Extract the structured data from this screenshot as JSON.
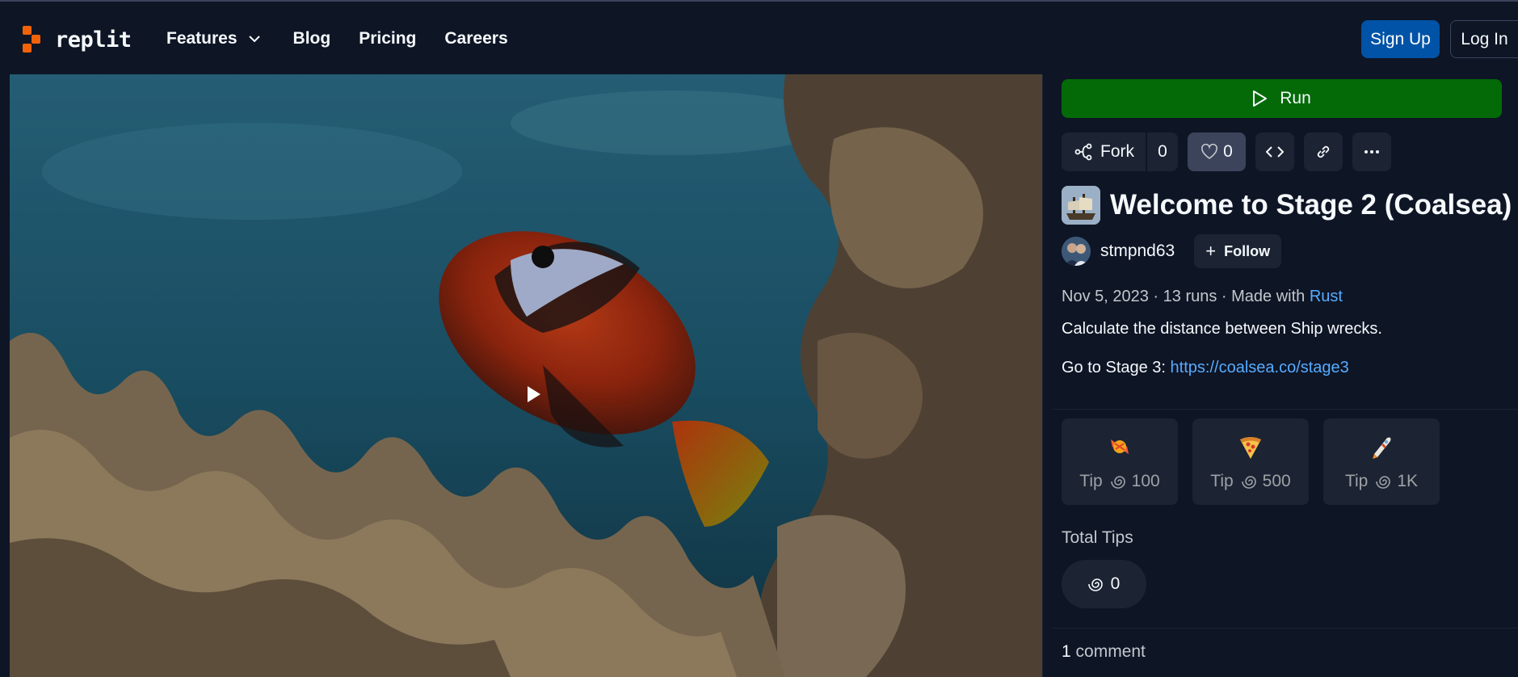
{
  "header": {
    "logo_text": "replit",
    "nav": [
      {
        "label": "Features",
        "has_dropdown": true
      },
      {
        "label": "Blog"
      },
      {
        "label": "Pricing"
      },
      {
        "label": "Careers"
      }
    ],
    "signup_label": "Sign Up",
    "login_label": "Log In"
  },
  "repl": {
    "run_label": "Run",
    "fork_label": "Fork",
    "fork_count": "0",
    "like_count": "0",
    "title": "Welcome to Stage 2 (Coalsea)",
    "author": "stmpnd63",
    "follow_label": "Follow",
    "date": "Nov 5, 2023",
    "runs": "13 runs",
    "made_with_prefix": "Made with",
    "language": "Rust",
    "description": "Calculate the distance between Ship wrecks.",
    "stage_prefix": "Go to Stage 3:",
    "stage_link": "https://coalsea.co/stage3"
  },
  "tips": [
    {
      "icon": "candy-icon",
      "label": "Tip",
      "amount": "100"
    },
    {
      "icon": "pizza-icon",
      "label": "Tip",
      "amount": "500"
    },
    {
      "icon": "rocket-icon",
      "label": "Tip",
      "amount": "1K"
    }
  ],
  "total_tips_label": "Total Tips",
  "total_tips_value": "0",
  "comments": {
    "count": "1",
    "label": "comment"
  },
  "colors": {
    "background": "#0e1525",
    "run_button": "#036a07",
    "signup_button": "#0053a6",
    "link": "#57abff",
    "brand_orange": "#f26207"
  }
}
